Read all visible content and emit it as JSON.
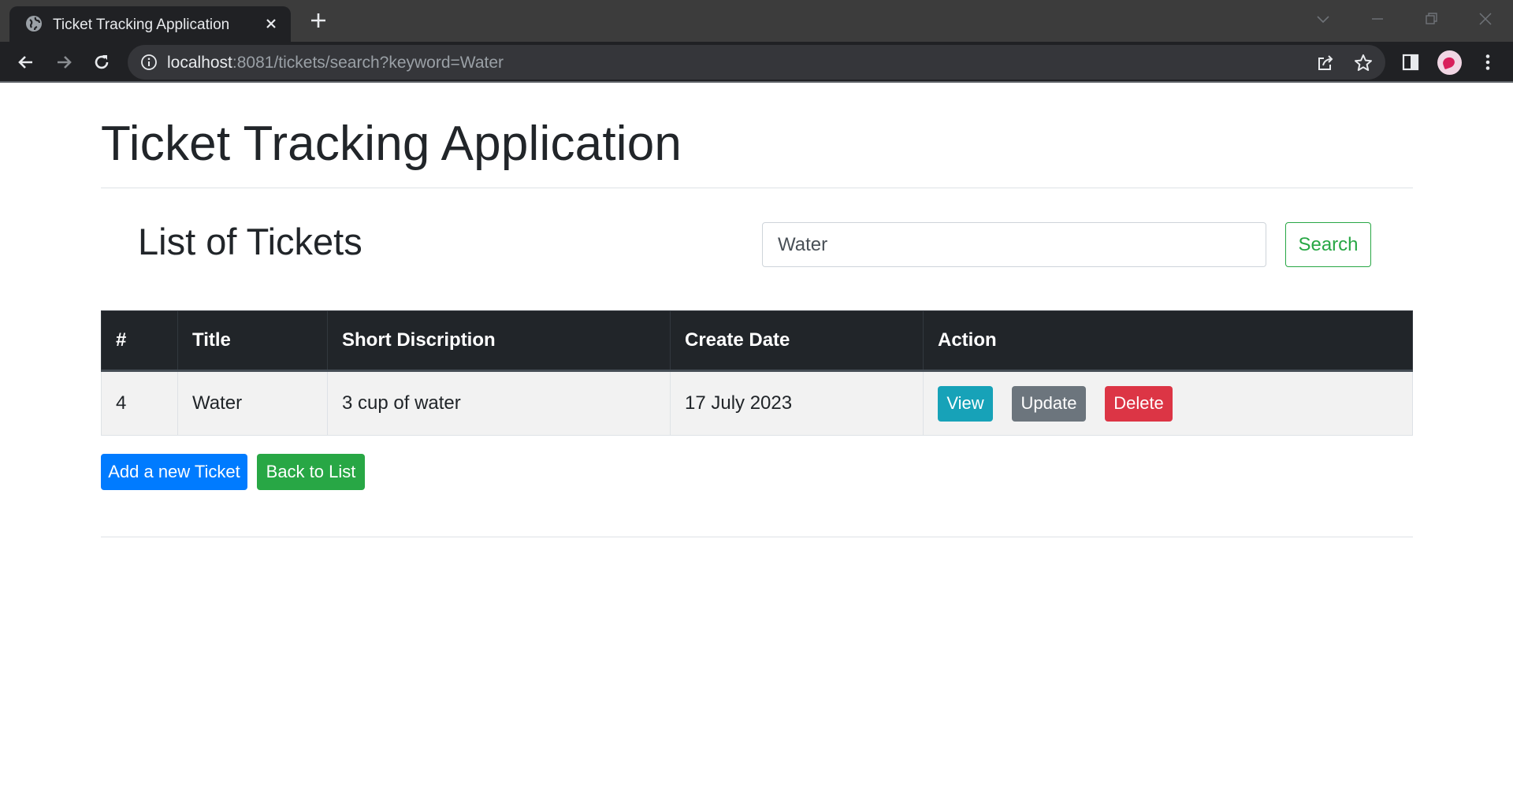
{
  "browser": {
    "tab_title": "Ticket Tracking Application",
    "url_host": "localhost",
    "url_path": ":8081/tickets/search?keyword=Water"
  },
  "page": {
    "app_title": "Ticket Tracking Application",
    "list_title": "List of Tickets",
    "search": {
      "value": "Water",
      "button_label": "Search"
    },
    "table": {
      "headers": [
        "#",
        "Title",
        "Short Discription",
        "Create Date",
        "Action"
      ],
      "rows": [
        {
          "id": "4",
          "title": "Water",
          "description": "3 cup of water",
          "create_date": "17 July 2023",
          "actions": {
            "view": "View",
            "update": "Update",
            "delete": "Delete"
          }
        }
      ]
    },
    "add_button": "Add a new Ticket",
    "back_button": "Back to List"
  },
  "colors": {
    "header_bg": "#212529",
    "view": "#17a2b8",
    "update": "#6c757d",
    "delete": "#dc3545",
    "primary": "#007bff",
    "success": "#28a745"
  }
}
